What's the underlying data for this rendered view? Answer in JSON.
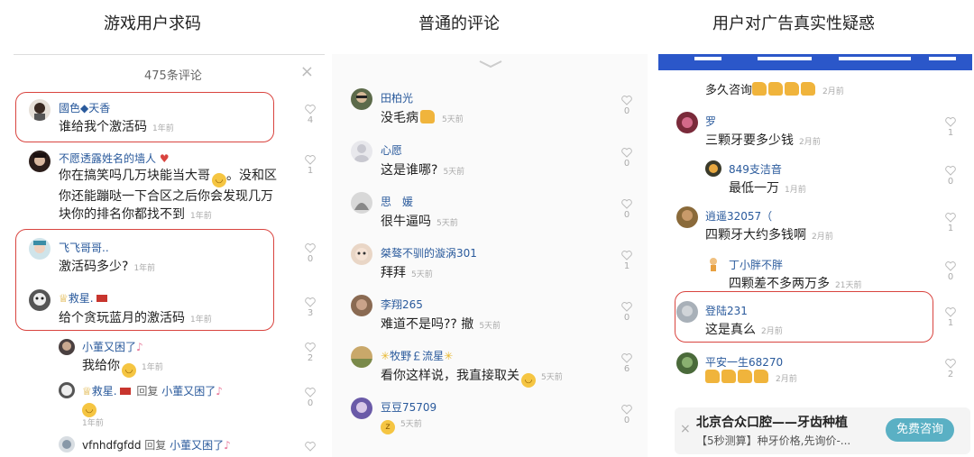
{
  "titles": {
    "p1": "游戏用户求码",
    "p2": "普通的评论",
    "p3": "用户对广告真实性疑惑"
  },
  "p1": {
    "count": "475条评论",
    "close": "×",
    "comments": [
      {
        "name": "國色◆天香",
        "text": "谁给我个激活码",
        "time": "1年前",
        "likes": "4"
      },
      {
        "name": "不愿透露姓名的墙人",
        "lines": [
          "你在搞笑吗几万块能当大哥",
          "你还能蹦哒一下合区之后你会发现几万",
          "块你的排名你都找不到"
        ],
        "line1_suffix": "。没和区",
        "time": "1年前",
        "likes": "1"
      },
      {
        "name": "飞飞哥哥..",
        "text": "激活码多少?",
        "time": "1年前",
        "likes": "0"
      },
      {
        "name": "救星.",
        "text": "给个贪玩蓝月的激活码",
        "time": "1年前",
        "likes": "3"
      },
      {
        "name": "小董又困了",
        "text": "我给你",
        "time": "1年前",
        "likes": "2"
      },
      {
        "name": "救星.",
        "reply_word": "回复",
        "reply_to": "小董又困了",
        "time": "1年前",
        "likes": "0"
      },
      {
        "name": "vfnhdfgfdd",
        "reply_word": "回复",
        "reply_to": "小董又困了"
      }
    ]
  },
  "p2": {
    "comments": [
      {
        "name": "田柏光",
        "text": "没毛病",
        "time": "5天前",
        "likes": "0"
      },
      {
        "name": "心愿",
        "text": "这是谁哪?",
        "time": "5天前",
        "likes": "0"
      },
      {
        "name": "思　媛",
        "text": "很牛逼吗",
        "time": "5天前",
        "likes": "0"
      },
      {
        "name": "桀骜不驯的漩涡301",
        "text": "拜拜",
        "time": "5天前",
        "likes": "1"
      },
      {
        "name": "李翔265",
        "text": "难道不是吗?? 撤",
        "time": "5天前",
        "likes": "0"
      },
      {
        "name": "牧野￡流星",
        "text": "看你这样说，我直接取关",
        "time": "5天前",
        "likes": "6"
      },
      {
        "name": "豆豆75709",
        "text": "",
        "time": "5天前",
        "likes": "0"
      }
    ]
  },
  "p3": {
    "top_text": "多久咨询",
    "top_time": "2月前",
    "comments": [
      {
        "name": "罗",
        "text": "三颗牙要多少钱",
        "time": "2月前",
        "likes": "1"
      },
      {
        "name": "849支洁音",
        "text": "最低一万",
        "time": "1月前",
        "likes": "0"
      },
      {
        "name": "逍遥32057（",
        "text": "四颗牙大约多钱啊",
        "time": "2月前",
        "likes": "1"
      },
      {
        "name": "丁小胖不胖",
        "text": "四颗差不多两万多",
        "time": "21天前",
        "likes": "0"
      },
      {
        "name": "登陆231",
        "text": "这是真么",
        "time": "2月前",
        "likes": "1"
      },
      {
        "name": "平安一生68270",
        "text": "",
        "time": "2月前",
        "likes": "2"
      }
    ],
    "ad": {
      "title": "北京合众口腔——牙齿种植",
      "subtitle": "【5秒测算】种牙价格,先询价-...",
      "button": "免费咨询",
      "close": "×"
    }
  },
  "colors": {
    "highlight": "#d9443f",
    "name": "#2a5a9c",
    "ad_button": "#5ab0c4"
  }
}
